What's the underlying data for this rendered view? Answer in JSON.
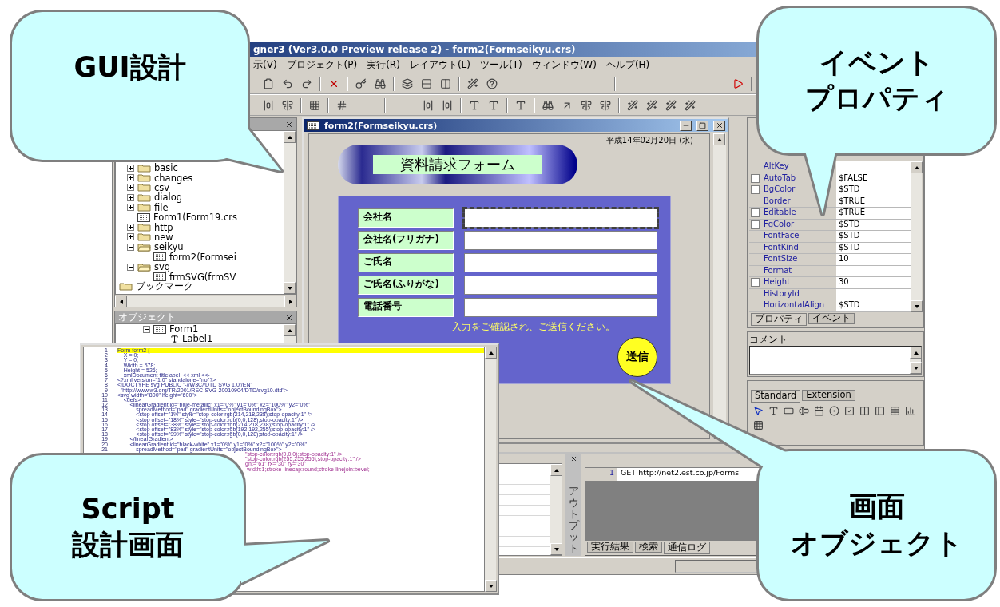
{
  "callouts": [
    {
      "lines": [
        "GUI設計"
      ]
    },
    {
      "lines": [
        "イベント",
        "プロパティ"
      ]
    },
    {
      "lines": [
        "Script",
        "設計画面"
      ]
    },
    {
      "lines": [
        "画面",
        "オブジェクト"
      ]
    }
  ],
  "ide": {
    "title": "gner3 (Ver3.0.0 Preview release 2) - form2(Formseikyu.crs)",
    "menu": [
      "示(V)",
      "プロジェクト(P)",
      "実行(R)",
      "レイアウト(L)",
      "ツール(T)",
      "ウィンドウ(W)",
      "ヘルプ(H)"
    ]
  },
  "project_panel": {
    "items": [
      {
        "label": "basic",
        "kind": "folder",
        "expanded": false
      },
      {
        "label": "changes",
        "kind": "folder",
        "expanded": false
      },
      {
        "label": "csv",
        "kind": "folder",
        "expanded": false
      },
      {
        "label": "dialog",
        "kind": "folder",
        "expanded": false
      },
      {
        "label": "file",
        "kind": "folder",
        "expanded": false
      },
      {
        "label": "Form1(Form19.crs",
        "kind": "form"
      },
      {
        "label": "http",
        "kind": "folder",
        "expanded": false
      },
      {
        "label": "new",
        "kind": "folder",
        "expanded": false
      },
      {
        "label": "seikyu",
        "kind": "folder",
        "expanded": true,
        "children": [
          {
            "label": "form2(Formsei",
            "kind": "form"
          }
        ]
      },
      {
        "label": "svg",
        "kind": "folder",
        "expanded": true,
        "children": [
          {
            "label": "frmSVG(frmSV",
            "kind": "form"
          }
        ]
      }
    ],
    "bookmark": "ブックマーク"
  },
  "objects_panel": {
    "title": "オブジェクト",
    "root": "Form1",
    "child": "Label1"
  },
  "form_window": {
    "title": "form2(Formseikyu.crs)",
    "date": "平成14年02月20日 (水)",
    "heading": "資料請求フォーム",
    "fields": [
      {
        "label": "会社名",
        "selected": true
      },
      {
        "label": "会社名(フリガナ)",
        "selected": false
      },
      {
        "label": "ご氏名",
        "selected": false
      },
      {
        "label": "ご氏名(ふりがな)",
        "selected": false
      },
      {
        "label": "電話番号",
        "selected": false
      }
    ],
    "note": "入力をご確認され、ご送信ください。",
    "submit": "送信"
  },
  "properties": {
    "rows": [
      {
        "name": "AltKey",
        "kind": "plain"
      },
      {
        "name": "AutoTab",
        "value": "$FALSE",
        "kind": "check",
        "checked": false
      },
      {
        "name": "BgColor",
        "value": "$STD",
        "kind": "check",
        "checked": false
      },
      {
        "name": "Border",
        "value": "$TRUE",
        "kind": "plain"
      },
      {
        "name": "Editable",
        "value": "$TRUE",
        "kind": "check",
        "checked": false
      },
      {
        "name": "FgColor",
        "value": "$STD",
        "kind": "check",
        "checked": false
      },
      {
        "name": "FontFace",
        "value": "$STD",
        "kind": "plain"
      },
      {
        "name": "FontKind",
        "value": "$STD",
        "kind": "plain"
      },
      {
        "name": "FontSize",
        "value": "10",
        "kind": "plain"
      },
      {
        "name": "Format",
        "kind": "plain"
      },
      {
        "name": "Height",
        "value": "30",
        "kind": "check",
        "checked": false
      },
      {
        "name": "HistoryId",
        "kind": "plain"
      },
      {
        "name": "HorizontalAlign",
        "value": "$STD",
        "kind": "plain"
      }
    ],
    "tabs": [
      {
        "label": "プロパティ",
        "selected": true
      },
      {
        "label": "イベント",
        "selected": false
      }
    ],
    "comment_label": "コメント"
  },
  "toolbox": {
    "tabs": [
      {
        "label": "Standard",
        "selected": true
      },
      {
        "label": "Extension",
        "selected": false
      }
    ]
  },
  "output": {
    "side_label": "アウトプット",
    "log": [
      {
        "number": "1",
        "text": "GET http://net2.est.co.jp/Forms"
      }
    ],
    "tabs": [
      {
        "label": "実行結果",
        "selected": false
      },
      {
        "label": "検索",
        "selected": false
      },
      {
        "label": "通信ログ",
        "selected": true
      }
    ]
  },
  "script_window": {
    "lines": [
      {
        "number": "1",
        "code": "Form form2 {",
        "highlighted": true
      },
      {
        "number": "2",
        "code": "    X = 0;",
        "highlighted": false
      },
      {
        "number": "3",
        "code": "    Y = 0;",
        "highlighted": false
      },
      {
        "number": "4",
        "code": "    Width = 578;",
        "highlighted": false
      },
      {
        "number": "5",
        "code": "    Height = 526;",
        "highlighted": false
      },
      {
        "number": "6",
        "code": "    xmlDocument titlelabel  << xml <<-",
        "highlighted": false
      },
      {
        "number": "7",
        "code": "<?xml version=\"1.0\" standalone=\"no\"?>",
        "highlighted": false
      },
      {
        "number": "8",
        "code": "<!DOCTYPE svg PUBLIC \"-//W3C//DTD SVG 1.0//EN\"",
        "highlighted": false
      },
      {
        "number": "9",
        "code": "  \"http://www.w3.org/TR/2001/REC-SVG-20010904/DTD/svg10.dtd\">",
        "highlighted": false
      },
      {
        "number": "10",
        "code": "<svg width=\"800\" height=\"600\">",
        "highlighted": false
      },
      {
        "number": "11",
        "code": "    <defs>",
        "highlighted": false
      },
      {
        "number": "12",
        "code": "        <linearGradient id=\"blue-metallic\" x1=\"0%\" y1=\"0%\" x2=\"100%\" y2=\"0%\"",
        "highlighted": false
      },
      {
        "number": "13",
        "code": "            spreadMethod=\"pad\" gradientUnits=\"objectBoundingBox\">",
        "highlighted": false
      },
      {
        "number": "14",
        "code": "            <stop offset=\"1%\" style=\"stop-color:rgb(214,218,238);stop-opacity:1\" />",
        "highlighted": false
      },
      {
        "number": "15",
        "code": "            <stop offset=\"18%\" style=\"stop-color:rgb(0,0,128);stop-opacity:1\" />",
        "highlighted": false
      },
      {
        "number": "16",
        "code": "            <stop offset=\"38%\" style=\"stop-color:rgb(214,218,238);stop-opacity:1\" />",
        "highlighted": false
      },
      {
        "number": "17",
        "code": "            <stop offset=\"83%\" style=\"stop-color:rgb(192,192,255);stop-opacity:1\" />",
        "highlighted": false
      },
      {
        "number": "18",
        "code": "            <stop offset=\"99%\" style=\"stop-color:rgb(0,0,128);stop-opacity:1\" />",
        "highlighted": false
      },
      {
        "number": "19",
        "code": "        </linearGradient>",
        "highlighted": false
      },
      {
        "number": "20",
        "code": "        <linearGradient id=\"black-white\" x1=\"0%\" y1=\"0%\" x2=\"100%\" y2=\"0%\"",
        "highlighted": false
      },
      {
        "number": "21",
        "code": "            spreadMethod=\"pad\" gradientUnits=\"objectBoundingBox\">",
        "highlighted": false
      },
      {
        "code": "\"stop-color:rgb(0,0,0);stop-opacity:1\" />",
        "highlighted": false,
        "kind": "clipped"
      },
      {
        "code": "\"stop-color:rgb(255,255,255);stop-opacity:1\" />",
        "highlighted": false,
        "kind": "clipped"
      },
      {
        "code": "ght=\"61\" rx=\"30\" ry=\"30\"",
        "highlighted": false,
        "kind": "clipped"
      },
      {
        "code": "-width:1;stroke-linecap:round;stroke-linejoin:bevel;",
        "highlighted": false,
        "kind": "clipped"
      }
    ]
  }
}
